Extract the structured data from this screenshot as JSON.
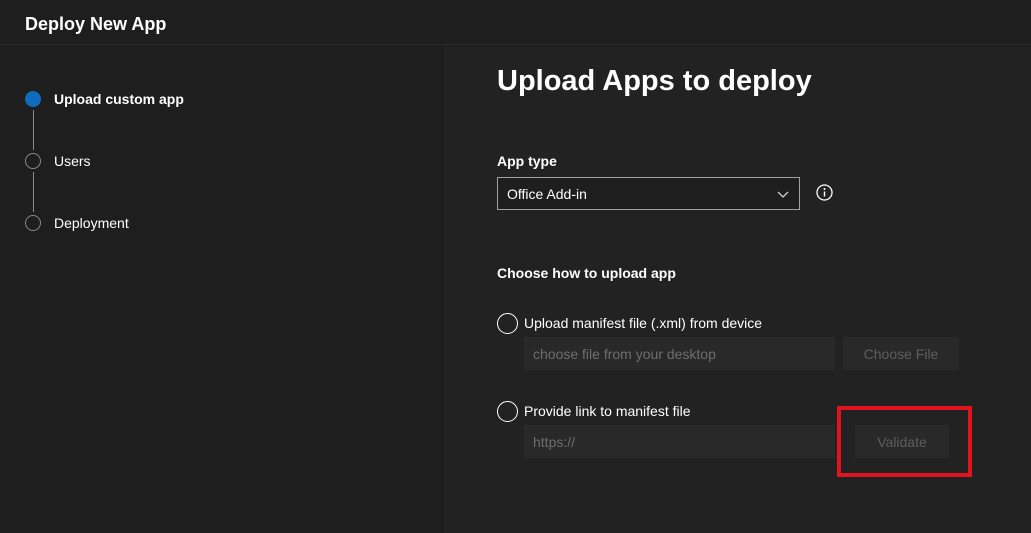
{
  "window": {
    "title": "Deploy New App"
  },
  "steps": [
    {
      "label": "Upload custom app",
      "state": "active"
    },
    {
      "label": "Users",
      "state": "pending"
    },
    {
      "label": "Deployment",
      "state": "pending"
    }
  ],
  "main": {
    "heading": "Upload Apps to deploy",
    "app_type": {
      "label": "App type",
      "selected": "Office Add-in"
    },
    "upload_method": {
      "label": "Choose how to upload app",
      "options": [
        {
          "label": "Upload manifest file (.xml) from device",
          "input_placeholder": "choose file from your desktop",
          "button_label": "Choose File"
        },
        {
          "label": "Provide link to manifest file",
          "input_placeholder": "https://",
          "button_label": "Validate"
        }
      ]
    }
  },
  "colors": {
    "accent": "#0f6cbd",
    "annotation": "#e0141e",
    "background": "#1e1e1e"
  },
  "icons": [
    "chevron-down-icon",
    "info-icon"
  ]
}
